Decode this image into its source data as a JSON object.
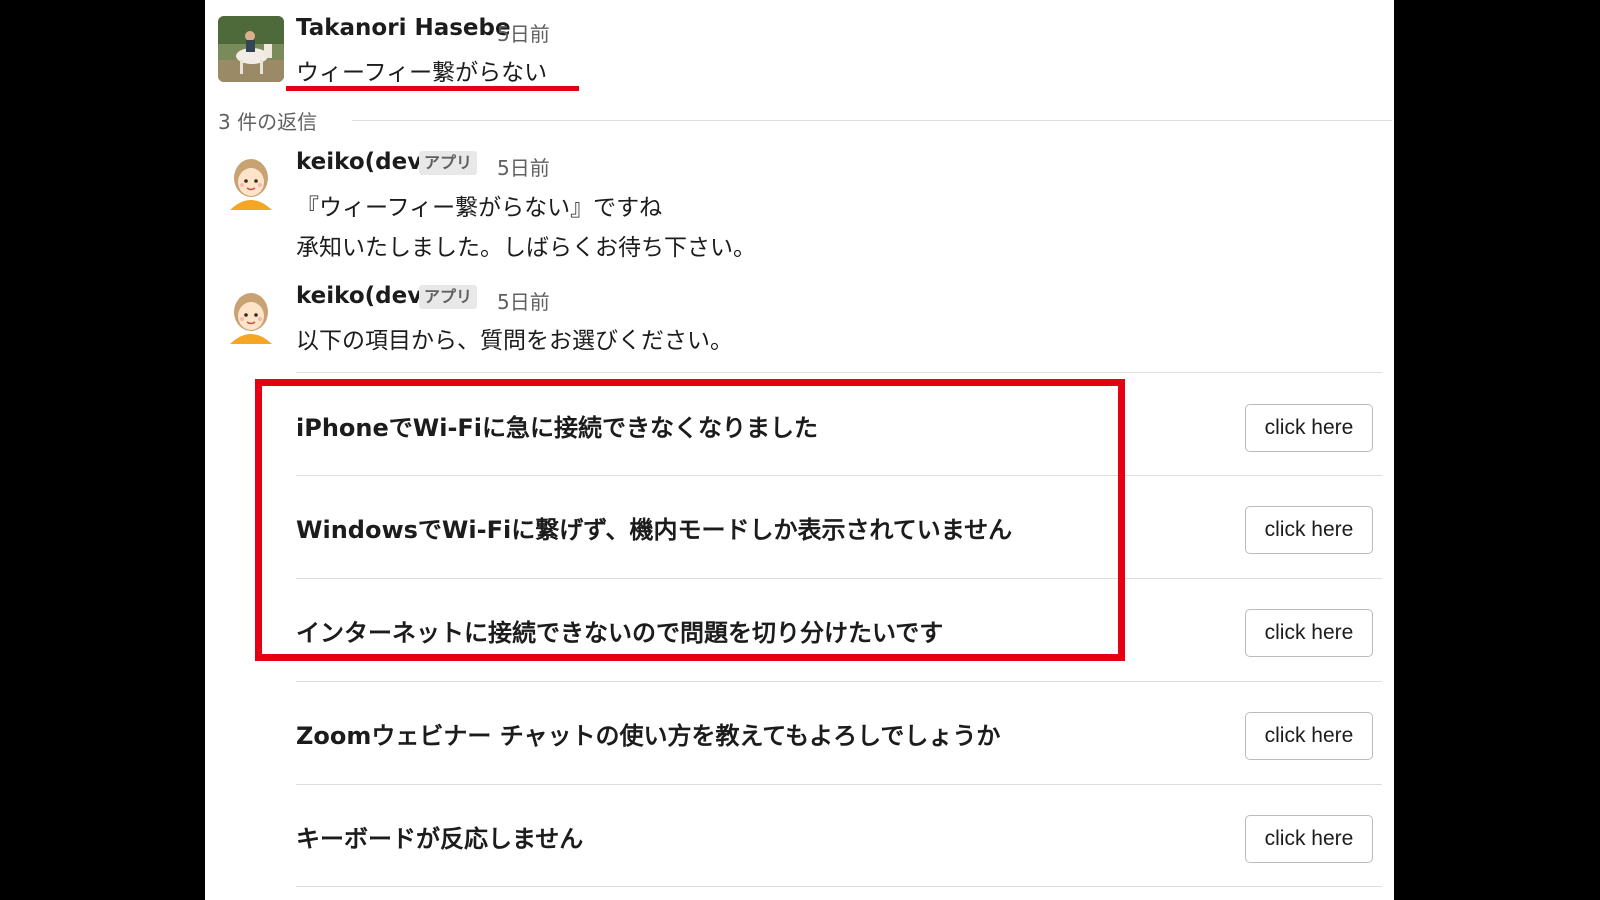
{
  "thread": {
    "parent": {
      "author": "Takanori Hasebe",
      "time": "5日前",
      "text": "ウィーフィー繋がらない"
    },
    "replies_label": "3 件の返信",
    "replies": [
      {
        "author": "keiko(dev)",
        "badge": "アプリ",
        "time": "5日前",
        "lines": [
          "『ウィーフィー繋がらない』ですね",
          "承知いたしました。しばらくお待ち下さい。"
        ]
      },
      {
        "author": "keiko(dev)",
        "badge": "アプリ",
        "time": "5日前",
        "lines": [
          "以下の項目から、質問をお選びください。"
        ]
      }
    ],
    "questions": [
      {
        "text": "iPhoneでWi-Fiに急に接続できなくなりました",
        "button": "click here"
      },
      {
        "text": "WindowsでWi-Fiに繋げず、機内モードしか表示されていません",
        "button": "click here"
      },
      {
        "text": "インターネットに接続できないので問題を切り分けたいです",
        "button": "click here"
      },
      {
        "text": "Zoomウェビナー チャットの使い方を教えてもよろしでしょうか",
        "button": "click here"
      },
      {
        "text": "キーボードが反応しません",
        "button": "click here"
      }
    ]
  },
  "colors": {
    "highlight": "#e60012",
    "background": "#ffffff",
    "letterbox": "#000000"
  },
  "icons": {
    "parent_avatar": "horse-rider-avatar",
    "bot_avatar": "cartoon-girl-avatar"
  }
}
